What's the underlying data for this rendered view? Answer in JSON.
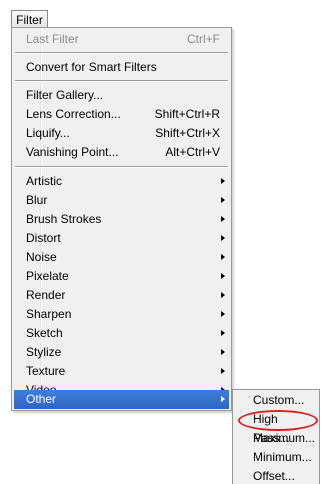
{
  "menubar": {
    "label": "Filter"
  },
  "menu": {
    "groups": [
      [
        {
          "label": "Last Filter",
          "shortcut": "Ctrl+F"
        }
      ],
      [
        {
          "label": "Convert for Smart Filters"
        }
      ],
      [
        {
          "label": "Filter Gallery..."
        },
        {
          "label": "Lens Correction...",
          "shortcut": "Shift+Ctrl+R"
        },
        {
          "label": "Liquify...",
          "shortcut": "Shift+Ctrl+X"
        },
        {
          "label": "Vanishing Point...",
          "shortcut": "Alt+Ctrl+V"
        }
      ],
      [
        {
          "label": "Artistic"
        },
        {
          "label": "Blur"
        },
        {
          "label": "Brush Strokes"
        },
        {
          "label": "Distort"
        },
        {
          "label": "Noise"
        },
        {
          "label": "Pixelate"
        },
        {
          "label": "Render"
        },
        {
          "label": "Sharpen"
        },
        {
          "label": "Sketch"
        },
        {
          "label": "Stylize"
        },
        {
          "label": "Texture"
        },
        {
          "label": "Video"
        },
        {
          "label": "Other"
        }
      ]
    ]
  },
  "submenu": {
    "items": [
      {
        "label": "Custom..."
      },
      {
        "label": "High Pass..."
      },
      {
        "label": "Maximum..."
      },
      {
        "label": "Minimum..."
      },
      {
        "label": "Offset..."
      }
    ]
  },
  "colors": {
    "highlight": "#2f64c3",
    "annotation": "#e02020",
    "menu_bg": "#f0f0f0"
  }
}
